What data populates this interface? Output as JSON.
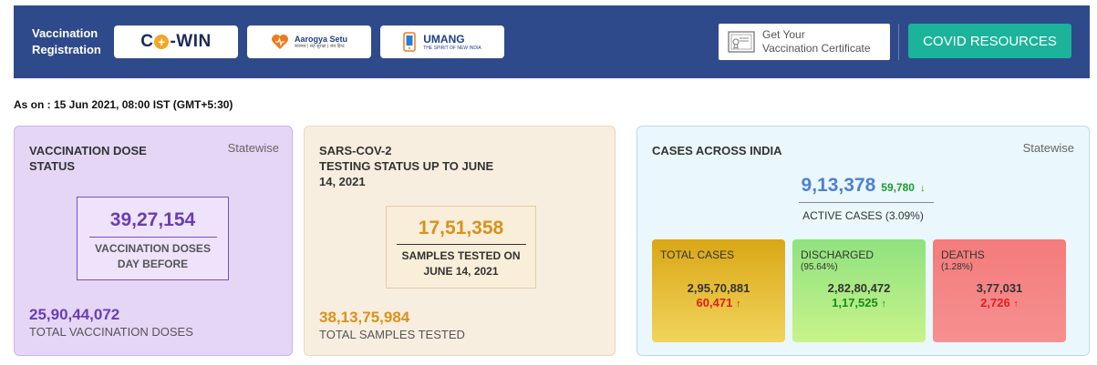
{
  "header": {
    "vaccination_registration": "Vaccination Registration",
    "cowin": {
      "prefix": "C",
      "plus": "+",
      "suffix": "-WIN"
    },
    "aarogya": {
      "title": "Aarogya Setu",
      "tagline": "स्वास्थ्य | सह सुरक्षा | जय हिन्द"
    },
    "umang": {
      "title": "UMANG",
      "tagline": "THE SPIRIT OF NEW INDIA"
    },
    "certificate": {
      "line1": "Get Your",
      "line2": "Vaccination Certificate"
    },
    "covid_resources": "COVID RESOURCES"
  },
  "as_on": "As on : 15 Jun 2021, 08:00 IST (GMT+5:30)",
  "vaccination": {
    "title_line1": "VACCINATION DOSE",
    "title_line2": "STATUS",
    "statewise": "Statewise",
    "day_before_value": "39,27,154",
    "day_before_label_line1": "VACCINATION DOSES",
    "day_before_label_line2": "DAY BEFORE",
    "total_value": "25,90,44,072",
    "total_label": "TOTAL VACCINATION DOSES"
  },
  "testing": {
    "title_line1": "SARS-COV-2",
    "title_line2": "TESTING STATUS UP TO JUNE",
    "title_line3": "14, 2021",
    "samples_value": "17,51,358",
    "samples_label_line1": "SAMPLES TESTED ON",
    "samples_label_line2": "JUNE 14, 2021",
    "total_value": "38,13,75,984",
    "total_label": "TOTAL SAMPLES TESTED"
  },
  "cases": {
    "title": "CASES ACROSS INDIA",
    "statewise": "Statewise",
    "active_value": "9,13,378",
    "active_delta": "59,780",
    "active_arrow": "↓",
    "active_label": "ACTIVE CASES (3.09%)",
    "total": {
      "label": "TOTAL CASES",
      "value": "2,95,70,881",
      "delta": "60,471",
      "arrow": "↑"
    },
    "discharged": {
      "label": "DISCHARGED",
      "percent": "(95.64%)",
      "value": "2,82,80,472",
      "delta": "1,17,525",
      "arrow": "↑"
    },
    "deaths": {
      "label": "DEATHS",
      "percent": "(1.28%)",
      "value": "3,77,031",
      "delta": "2,726",
      "arrow": "↑"
    }
  },
  "colors": {
    "banner": "#2f4a8a",
    "covid_button": "#1bb39a",
    "vacc_accent": "#6a3db5",
    "test_accent": "#d9911c",
    "active_accent": "#4f7fd6",
    "increase_red": "#e01e1e",
    "increase_green": "#1a8a1f"
  }
}
